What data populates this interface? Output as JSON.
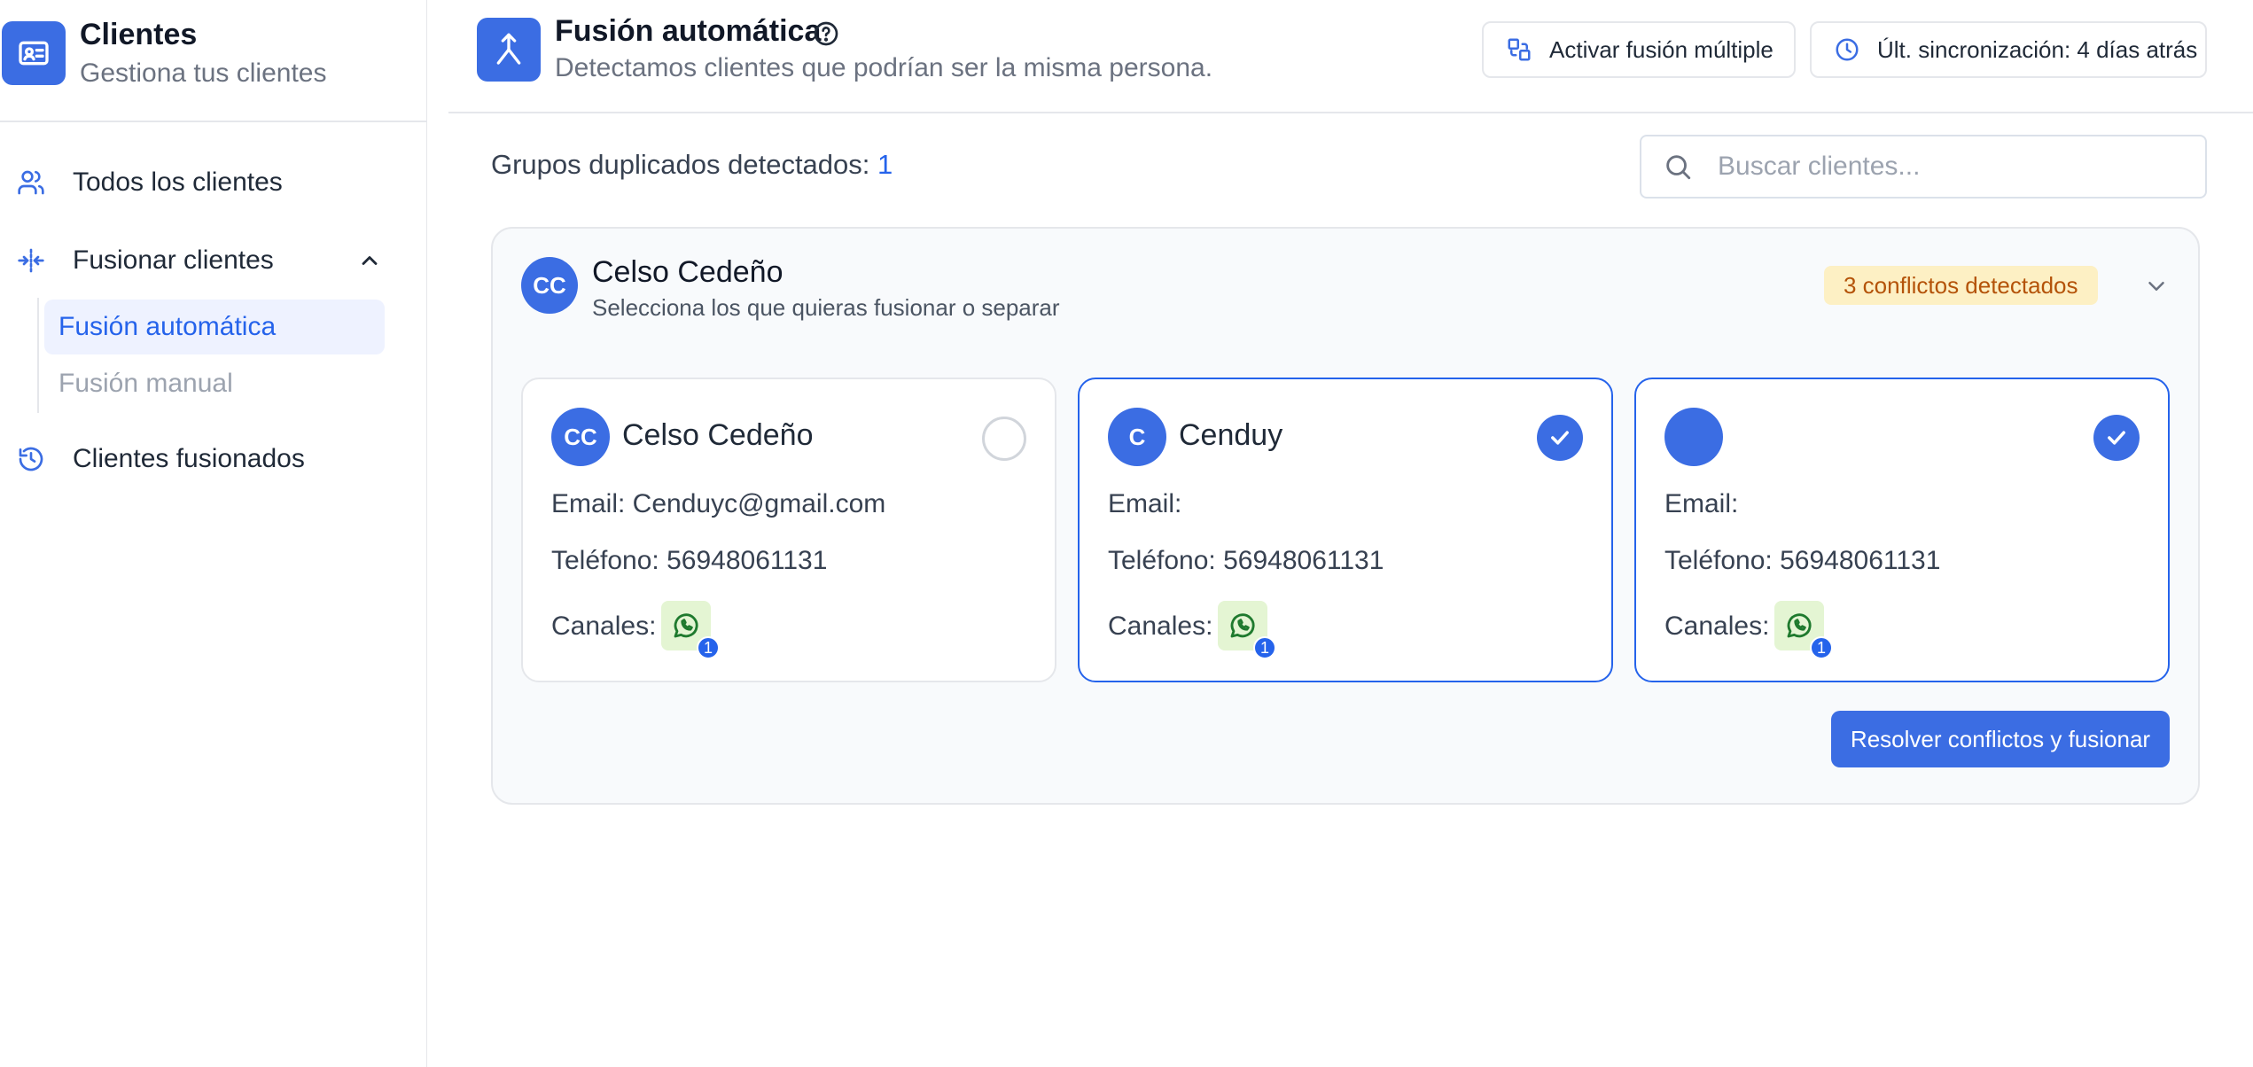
{
  "sidebar": {
    "app_title": "Clientes",
    "app_subtitle": "Gestiona tus clientes",
    "app_icon": "contact-card-icon",
    "items": [
      {
        "label": "Todos los clientes",
        "icon": "users-icon"
      },
      {
        "label": "Fusionar clientes",
        "icon": "merge-arrows-icon",
        "expanded": true
      },
      {
        "label": "Clientes fusionados",
        "icon": "history-icon"
      }
    ],
    "subitems": [
      {
        "label": "Fusión automática",
        "active": true
      },
      {
        "label": "Fusión manual",
        "active": false
      }
    ]
  },
  "header": {
    "title": "Fusión automática",
    "subtitle": "Detectamos clientes que podrían ser la misma persona.",
    "icon": "merge-icon",
    "buttons": {
      "multi_merge": "Activar fusión múltiple",
      "last_sync": "Últ. sincronización: 4 días atrás"
    }
  },
  "main": {
    "dup_label": "Grupos duplicados detectados: ",
    "dup_count": "1",
    "search_placeholder": "Buscar clientes..."
  },
  "group": {
    "initials": "CC",
    "name": "Celso Cedeño",
    "description": "Selecciona los que quieras fusionar o separar",
    "conflicts": "3 conflictos detectados",
    "action": "Resolver conflictos y fusionar",
    "cards": [
      {
        "initials": "CC",
        "name": "Celso Cedeño",
        "email": "Email: Cenduyc@gmail.com",
        "phone": "Teléfono: 56948061131",
        "channels_label": "Canales:",
        "channel_count": "1",
        "selected": false
      },
      {
        "initials": "C",
        "name": "Cenduy",
        "email": "Email:",
        "phone": "Teléfono: 56948061131",
        "channels_label": "Canales:",
        "channel_count": "1",
        "selected": true
      },
      {
        "initials": "",
        "name": "",
        "email": "Email:",
        "phone": "Teléfono: 56948061131",
        "channels_label": "Canales:",
        "channel_count": "1",
        "selected": true
      }
    ]
  },
  "colors": {
    "accent": "#3b6de3",
    "link": "#2563eb",
    "badge_bg": "#fdf0c4",
    "badge_text": "#b45309",
    "whatsapp_bg": "#e4f5d3",
    "whatsapp_icon": "#1f7a2e"
  }
}
